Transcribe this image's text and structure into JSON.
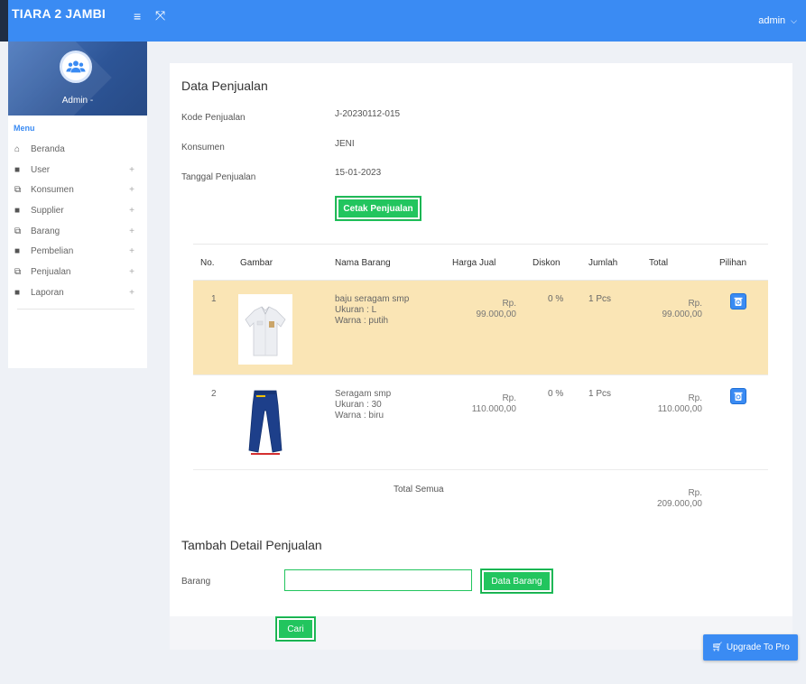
{
  "header": {
    "brand": "TIARA 2 JAMBI",
    "menu_icon": "hamburger-icon",
    "expand_icon": "expand-icon",
    "user": "admin"
  },
  "sidebar": {
    "profile_name": "Admin -",
    "menu_title": "Menu",
    "items": [
      {
        "label": "Beranda",
        "icon": "home-icon",
        "expandable": false
      },
      {
        "label": "User",
        "icon": "grid-icon",
        "expandable": true
      },
      {
        "label": "Konsumen",
        "icon": "window-icon",
        "expandable": true
      },
      {
        "label": "Supplier",
        "icon": "grid-icon",
        "expandable": true
      },
      {
        "label": "Barang",
        "icon": "window-icon",
        "expandable": true
      },
      {
        "label": "Pembelian",
        "icon": "grid-icon",
        "expandable": true
      },
      {
        "label": "Penjualan",
        "icon": "window-icon",
        "expandable": true
      },
      {
        "label": "Laporan",
        "icon": "grid-icon",
        "expandable": true
      }
    ]
  },
  "main": {
    "title": "Data Penjualan",
    "fields": [
      {
        "label": "Kode Penjualan",
        "value": "J-20230112-015"
      },
      {
        "label": "Konsumen",
        "value": "JENI"
      },
      {
        "label": "Tanggal Penjualan",
        "value": "15-01-2023"
      }
    ],
    "print_button": "Cetak Penjualan",
    "table": {
      "headers": [
        "No.",
        "Gambar",
        "Nama Barang",
        "Harga Jual",
        "Diskon",
        "Jumlah",
        "Total",
        "Pilihan"
      ],
      "rows": [
        {
          "no": "1",
          "name": "baju seragam smp",
          "size": "Ukuran : L",
          "color": "Warna : putih",
          "price_cur": "Rp.",
          "price": "99.000,00",
          "discount": "0 %",
          "qty": "1 Pcs",
          "total_cur": "Rp.",
          "total": "99.000,00",
          "highlight": true
        },
        {
          "no": "2",
          "name": "Seragam smp",
          "size": "Ukuran : 30",
          "color": "Warna : biru",
          "price_cur": "Rp.",
          "price": "110.000,00",
          "discount": "0 %",
          "qty": "1 Pcs",
          "total_cur": "Rp.",
          "total": "110.000,00",
          "highlight": false
        }
      ],
      "total_label": "Total Semua",
      "grand_total_cur": "Rp.",
      "grand_total": "209.000,00"
    },
    "add_title": "Tambah Detail Penjualan",
    "barang_label": "Barang",
    "barang_value": "",
    "data_barang_button": "Data Barang",
    "search_button": "Cari"
  },
  "upgrade_button": "Upgrade To Pro",
  "colors": {
    "primary": "#3a8bf3",
    "success": "#22c55e",
    "highlight": "#fae5b5",
    "sidebar_dark": "#1f2d44"
  }
}
